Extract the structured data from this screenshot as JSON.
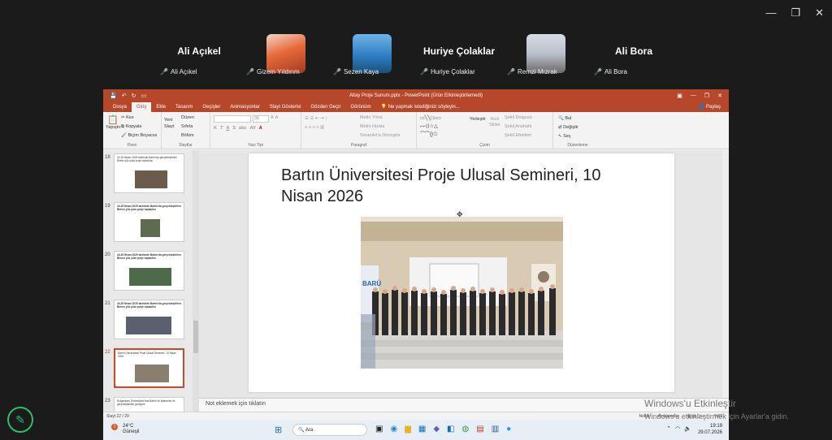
{
  "window_controls": {
    "minimize": "—",
    "restore": "❐",
    "close": "✕"
  },
  "participants": [
    {
      "big_name": "Ali Açıkel",
      "chip": "Ali Açıkel",
      "has_video": false
    },
    {
      "big_name": "",
      "chip": "Gizem Yıldırım",
      "has_video": true
    },
    {
      "big_name": "",
      "chip": "Sezen Kaya",
      "has_video": true
    },
    {
      "big_name": "Huriye Çolaklar",
      "chip": "Huriye Çolaklar",
      "has_video": false
    },
    {
      "big_name": "",
      "chip": "Remzi Mızrak",
      "has_video": true
    },
    {
      "big_name": "Ali Bora",
      "chip": "Ali Bora",
      "has_video": false
    }
  ],
  "ppt": {
    "title": "Altay Proje Sunum.pptx - PowerPoint (Ürün Etkinleştirilemedi)",
    "tabs": [
      "Dosya",
      "Giriş",
      "Ekle",
      "Tasarım",
      "Geçişler",
      "Animasyonlar",
      "Slayt Gösterisi",
      "Gözden Geçir",
      "Görünüm"
    ],
    "active_tab": "Giriş",
    "tell_me": "Ne yapmak istediğinizi söyleyin...",
    "share": "Paylaş",
    "ribbon": {
      "pano": {
        "paste": "Yapıştır",
        "cut": "Kes",
        "copy": "Kopyala",
        "format_painter": "Biçim Boyacısı",
        "label": "Pano"
      },
      "slaytlar": {
        "new_slide": "Yeni Slayt",
        "layout": "Düzen",
        "reset": "Sıfırla",
        "section": "Bölüm",
        "label": "Slaytlar"
      },
      "yazi_tipi": {
        "size": "36",
        "label": "Yazı Tipi"
      },
      "paragraf": {
        "text_dir": "Metin Yönü",
        "align_text": "Metni Hizala",
        "smartart": "SmartArt'a Dönüştür",
        "label": "Paragraf"
      },
      "cizim": {
        "arrange": "Yerleştir",
        "quick_styles": "Hızlı Stiller",
        "fill": "Şekil Dolgusu",
        "outline": "Şekil Anahattı",
        "effects": "Şekil Efektleri",
        "label": "Çizim"
      },
      "duzenleme": {
        "find": "Bul",
        "replace": "Değiştir",
        "select": "Seç",
        "label": "Düzenleme"
      }
    },
    "thumbnails": [
      {
        "num": "18",
        "text": "24-25 Nisan 2025 tarihinde Bartın'da gerçekleştirilen Birinci yüz yüze proje toplantısı",
        "selected": false
      },
      {
        "num": "19",
        "text": "24-25 Nisan 2025 tarihinde Bartın'da gerçekleştirilen Birinci yüz yüze proje toplantısı",
        "selected": false
      },
      {
        "num": "20",
        "text": "24-25 Nisan 2025 tarihinde Bartın'da gerçekleştirilen Birinci yüz yüze proje toplantısı",
        "selected": false
      },
      {
        "num": "21",
        "text": "24-25 Nisan 2025 tarihinde Bartın'da gerçekleştirilen Birinci yüz yüze proje toplantısı",
        "selected": false
      },
      {
        "num": "22",
        "text": "Bartın Üniversitesi Proje Ulusal Semineri, 10 Nisan 2026",
        "selected": true
      },
      {
        "num": "23",
        "text": "Bulgaristan Üniversitesi'nde Bartın ve işletmeler ile gerçekleştirilen görüşme",
        "selected": false
      }
    ],
    "slide_title": "Bartın Üniversitesi Proje Ulusal Semineri, 10 Nisan 2026",
    "photo_sign": "BARÜ",
    "notes_placeholder": "Not eklemek için tıklatın",
    "status": {
      "slide": "Slayt 22 / 29",
      "notes": "Notlar",
      "comments": "Açıklamalar",
      "zoom": "%62"
    }
  },
  "taskbar": {
    "temp": "24°C",
    "weather": "Güneşli",
    "search": "Ara",
    "time": "19:19",
    "date": "29.07.2026",
    "badge": "1"
  },
  "watermark": {
    "title": "Windows'u Etkinleştir",
    "sub": "Windows'u etkinleştirmek için Ayarlar'a gidin."
  },
  "colors": {
    "accent": "#b7472a",
    "mic_off": "#e04a3a",
    "pen": "#2bbf6b"
  }
}
